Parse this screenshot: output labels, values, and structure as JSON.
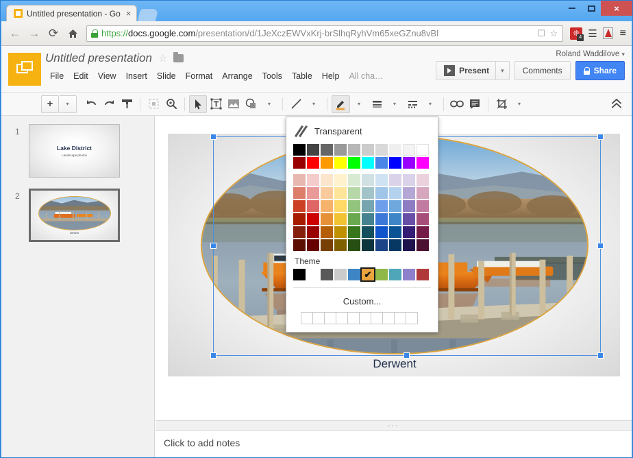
{
  "browser": {
    "tab": {
      "title": "Untitled presentation - Go",
      "close_label": "×",
      "favicon": "slides-favicon"
    },
    "new_tab_label": "",
    "window_controls": {
      "minimize": "minimize-icon",
      "maximize": "maximize-icon",
      "close": "×"
    },
    "nav": {
      "back": "←",
      "forward": "→",
      "reload": "⟳",
      "home": "⌂"
    },
    "omnibox": {
      "scheme": "https://",
      "host": "docs.google.com",
      "path": "/presentation/d/1JeXczEWVxKrj-brSlhqRyhVm65xeGZnu8vBl",
      "full_url": "https://docs.google.com/presentation/d/1JeXczEWVxKrj-brSlhqRyhVm65xeGZnu8vBl",
      "bookmark_star": "☆",
      "blocked_icon": "blocked-popups-icon"
    },
    "extensions": {
      "red_badge_count": "4",
      "menu_glyph": "≡"
    }
  },
  "docs": {
    "title": "Untitled presentation",
    "star": "☆",
    "folder": "folder-icon",
    "menus": [
      "File",
      "Edit",
      "View",
      "Insert",
      "Slide",
      "Format",
      "Arrange",
      "Tools",
      "Table",
      "Help"
    ],
    "save_status": "All cha…",
    "user": "Roland Waddilove",
    "user_caret": "▾",
    "buttons": {
      "present": "Present",
      "present_caret": "▾",
      "comments": "Comments",
      "share": "Share"
    }
  },
  "toolbar": {
    "new_slide": "+",
    "new_slide_caret": "▾",
    "undo": "undo-icon",
    "redo": "redo-icon",
    "paint_format": "paint-format-icon",
    "select_all": "select-all-icon",
    "zoom": "zoom-icon",
    "select_tool": "cursor-icon",
    "text_box": "text-box-icon",
    "insert_image": "image-icon",
    "shape": "shape-icon",
    "shape_caret": "▾",
    "line": "line-icon",
    "line_caret": "▾",
    "border_color": "border-color-icon",
    "border_color_caret": "▾",
    "border_weight": "border-weight-icon",
    "border_weight_caret": "▾",
    "border_dash": "border-dash-icon",
    "border_dash_caret": "▾",
    "insert_link": "link-icon",
    "insert_comment": "comment-icon",
    "crop": "crop-icon",
    "crop_caret": "▾",
    "collapse": "⌃⌃",
    "active_swatch_color": "#e8a33d"
  },
  "color_picker": {
    "transparent_label": "Transparent",
    "theme_label": "Theme",
    "custom_label": "Custom...",
    "selected_check": "✔",
    "selected_theme_index": 5,
    "rows": [
      [
        "#000000",
        "#434343",
        "#666666",
        "#999999",
        "#b7b7b7",
        "#cccccc",
        "#d9d9d9",
        "#efefef",
        "#f3f3f3",
        "#ffffff"
      ],
      [
        "#980000",
        "#ff0000",
        "#ff9900",
        "#ffff00",
        "#00ff00",
        "#00ffff",
        "#4a86e8",
        "#0000ff",
        "#9900ff",
        "#ff00ff"
      ],
      [
        "#e6b8af",
        "#f4cccc",
        "#fce5cd",
        "#fff2cc",
        "#d9ead3",
        "#d0e0e3",
        "#cfe2f3",
        "#d9d2e9",
        "#d9d2e9",
        "#ead1dc"
      ],
      [
        "#dd7e6b",
        "#ea9999",
        "#f9cb9c",
        "#ffe599",
        "#b6d7a8",
        "#a2c4c9",
        "#9fc5e8",
        "#b4d2ee",
        "#b4a7d6",
        "#d5a6bd"
      ],
      [
        "#cc4125",
        "#e06666",
        "#f6b26b",
        "#ffd966",
        "#93c47d",
        "#76a5af",
        "#6d9eeb",
        "#6fa8dc",
        "#8e7cc3",
        "#c27ba0"
      ],
      [
        "#a61c00",
        "#cc0000",
        "#e69138",
        "#f1c232",
        "#6aa84f",
        "#45818e",
        "#3c78d8",
        "#3d85c6",
        "#674ea7",
        "#a64d79"
      ],
      [
        "#85200c",
        "#990000",
        "#b45f06",
        "#bf9000",
        "#38761d",
        "#134f5c",
        "#1155cc",
        "#0b5394",
        "#351c75",
        "#741b47"
      ],
      [
        "#5b0f00",
        "#660000",
        "#783f04",
        "#7f6000",
        "#274e13",
        "#0c343d",
        "#1c4587",
        "#073763",
        "#20124d",
        "#4c1130"
      ]
    ],
    "theme_colors": [
      "#000000",
      "#ffffff",
      "#595959",
      "#cbcbcb",
      "#3e85c6",
      "#e8a33d",
      "#8fb849",
      "#4ea6b8",
      "#8f80cc",
      "#b03a3a"
    ],
    "custom_count": 10
  },
  "filmstrip": {
    "slides": [
      {
        "number": "1",
        "title": "Lake District",
        "subtitle": "Landscape photos",
        "selected": false
      },
      {
        "number": "2",
        "caption": "Derwent",
        "selected": true
      }
    ]
  },
  "canvas": {
    "caption": "Derwent",
    "image_alt": "Lake Derwent with orange wooden launch boat moored at stone jetty",
    "image_border_color": "#daa23c",
    "selection_color": "#3b87e8"
  },
  "notes": {
    "placeholder": "Click to add notes",
    "grip": "···"
  }
}
